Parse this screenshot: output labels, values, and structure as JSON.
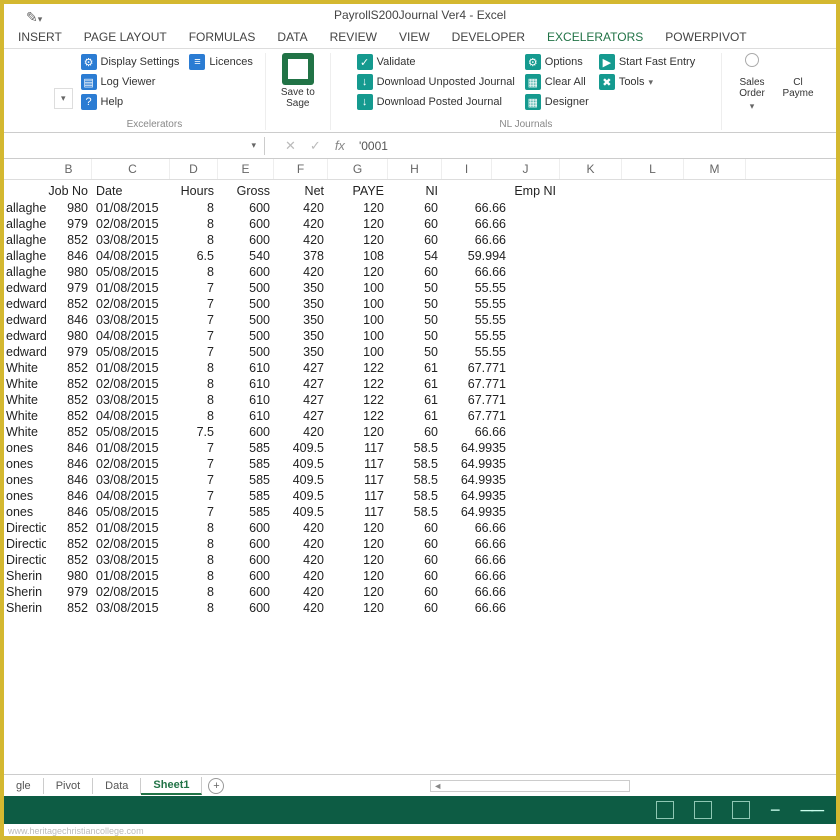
{
  "title": "PayrollS200Journal Ver4 - Excel",
  "menu": [
    "INSERT",
    "PAGE LAYOUT",
    "FORMULAS",
    "DATA",
    "REVIEW",
    "VIEW",
    "DEVELOPER",
    "EXCELERATORS",
    "POWERPIVOT"
  ],
  "ribbon": {
    "excelerators": {
      "label": "Excelerators",
      "display_settings": "Display Settings",
      "licences": "Licences",
      "log_viewer": "Log Viewer",
      "help": "Help"
    },
    "save_to_sage": "Save to Sage",
    "nl_journals": {
      "label": "NL Journals",
      "validate": "Validate",
      "download_unposted": "Download Unposted Journal",
      "download_posted": "Download Posted Journal",
      "options": "Options",
      "clear_all": "Clear All",
      "designer": "Designer",
      "start_fast_entry": "Start Fast Entry",
      "tools": "Tools"
    },
    "sales_order": "Sales Order",
    "payment": "Cl Payme"
  },
  "formula_bar": "'0001",
  "columns_letters": [
    "B",
    "C",
    "D",
    "E",
    "F",
    "G",
    "H",
    "I",
    "J",
    "K",
    "L",
    "M"
  ],
  "headers": [
    "",
    "Job No",
    "Date",
    "Hours",
    "Gross",
    "Net",
    "PAYE",
    "NI",
    "",
    "Emp NI"
  ],
  "rows": [
    [
      "allagher",
      "980",
      "01/08/2015",
      "8",
      "600",
      "420",
      "120",
      "60",
      "66.66"
    ],
    [
      "allagher",
      "979",
      "02/08/2015",
      "8",
      "600",
      "420",
      "120",
      "60",
      "66.66"
    ],
    [
      "allagher",
      "852",
      "03/08/2015",
      "8",
      "600",
      "420",
      "120",
      "60",
      "66.66"
    ],
    [
      "allagher",
      "846",
      "04/08/2015",
      "6.5",
      "540",
      "378",
      "108",
      "54",
      "59.994"
    ],
    [
      "allagher",
      "980",
      "05/08/2015",
      "8",
      "600",
      "420",
      "120",
      "60",
      "66.66"
    ],
    [
      "edward",
      "979",
      "01/08/2015",
      "7",
      "500",
      "350",
      "100",
      "50",
      "55.55"
    ],
    [
      "edward",
      "852",
      "02/08/2015",
      "7",
      "500",
      "350",
      "100",
      "50",
      "55.55"
    ],
    [
      "edward",
      "846",
      "03/08/2015",
      "7",
      "500",
      "350",
      "100",
      "50",
      "55.55"
    ],
    [
      "edward",
      "980",
      "04/08/2015",
      "7",
      "500",
      "350",
      "100",
      "50",
      "55.55"
    ],
    [
      "edward",
      "979",
      "05/08/2015",
      "7",
      "500",
      "350",
      "100",
      "50",
      "55.55"
    ],
    [
      "White",
      "852",
      "01/08/2015",
      "8",
      "610",
      "427",
      "122",
      "61",
      "67.771"
    ],
    [
      "White",
      "852",
      "02/08/2015",
      "8",
      "610",
      "427",
      "122",
      "61",
      "67.771"
    ],
    [
      "White",
      "852",
      "03/08/2015",
      "8",
      "610",
      "427",
      "122",
      "61",
      "67.771"
    ],
    [
      "White",
      "852",
      "04/08/2015",
      "8",
      "610",
      "427",
      "122",
      "61",
      "67.771"
    ],
    [
      "White",
      "852",
      "05/08/2015",
      "7.5",
      "600",
      "420",
      "120",
      "60",
      "66.66"
    ],
    [
      "ones",
      "846",
      "01/08/2015",
      "7",
      "585",
      "409.5",
      "117",
      "58.5",
      "64.9935"
    ],
    [
      "ones",
      "846",
      "02/08/2015",
      "7",
      "585",
      "409.5",
      "117",
      "58.5",
      "64.9935"
    ],
    [
      "ones",
      "846",
      "03/08/2015",
      "7",
      "585",
      "409.5",
      "117",
      "58.5",
      "64.9935"
    ],
    [
      "ones",
      "846",
      "04/08/2015",
      "7",
      "585",
      "409.5",
      "117",
      "58.5",
      "64.9935"
    ],
    [
      "ones",
      "846",
      "05/08/2015",
      "7",
      "585",
      "409.5",
      "117",
      "58.5",
      "64.9935"
    ],
    [
      "Direction",
      "852",
      "01/08/2015",
      "8",
      "600",
      "420",
      "120",
      "60",
      "66.66"
    ],
    [
      "Direction",
      "852",
      "02/08/2015",
      "8",
      "600",
      "420",
      "120",
      "60",
      "66.66"
    ],
    [
      "Direction",
      "852",
      "03/08/2015",
      "8",
      "600",
      "420",
      "120",
      "60",
      "66.66"
    ],
    [
      "Sherin",
      "980",
      "01/08/2015",
      "8",
      "600",
      "420",
      "120",
      "60",
      "66.66"
    ],
    [
      "Sherin",
      "979",
      "02/08/2015",
      "8",
      "600",
      "420",
      "120",
      "60",
      "66.66"
    ],
    [
      "Sherin",
      "852",
      "03/08/2015",
      "8",
      "600",
      "420",
      "120",
      "60",
      "66.66"
    ]
  ],
  "sheets": [
    "gle",
    "Pivot",
    "Data",
    "Sheet1"
  ],
  "active_sheet": 3,
  "watermark": "www.heritagechristiancollege.com"
}
